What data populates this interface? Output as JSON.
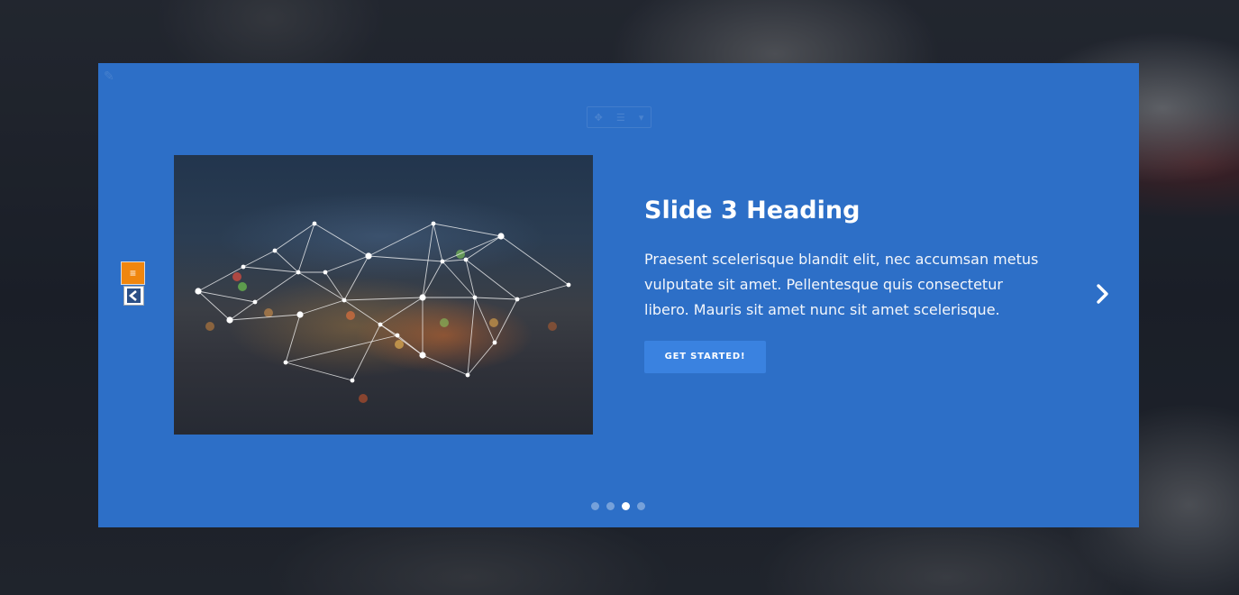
{
  "slide": {
    "heading": "Slide 3 Heading",
    "body": "Praesent scelerisque blandit elit, nec accumsan metus vulputate sit amet. Pellentesque quis consectetur libero. Mauris sit amet nunc sit amet scelerisque.",
    "button_label": "GET STARTED!",
    "image_icon": "network-city-image"
  },
  "pagination": {
    "total": 4,
    "active_index": 2
  },
  "controls": {
    "next_icon": "chevron-right-icon",
    "menu_icon": "hamburger-icon",
    "back_icon": "chevron-left-box-icon",
    "edit_icon": "pencil-icon"
  },
  "colors": {
    "panel": "#2d6fc7",
    "button": "#3a82e0",
    "menu_widget": "#f0860e"
  }
}
